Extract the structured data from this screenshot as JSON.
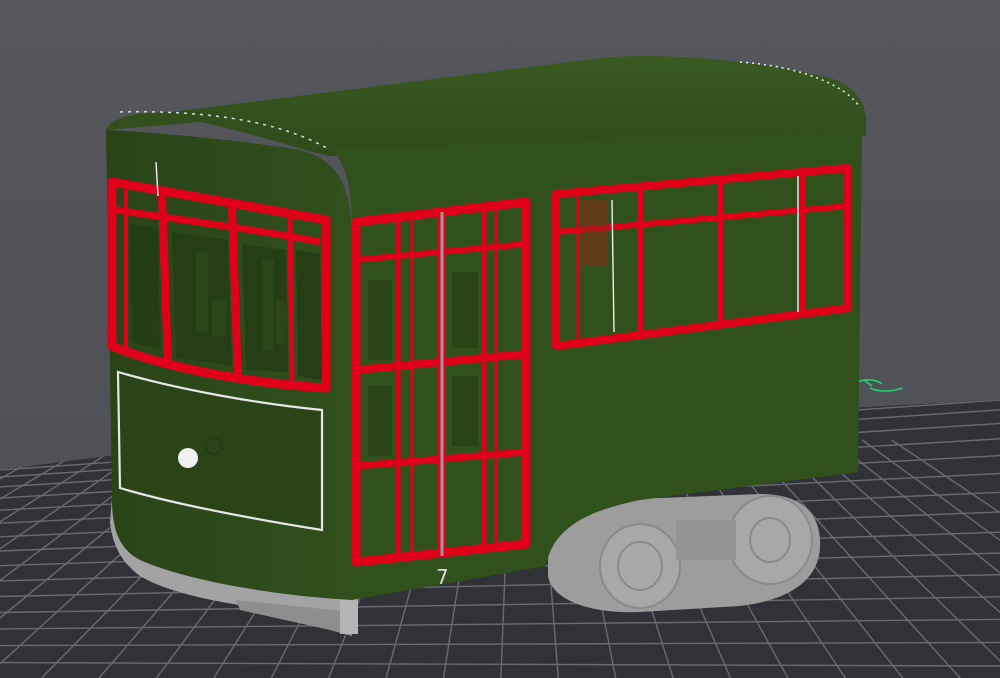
{
  "viewport": {
    "background_color": "#55565c",
    "bed_color": "#2f3036",
    "bed_grid_color": "#6a6b72"
  },
  "model": {
    "body_color": "#2f4a1c",
    "body_shade_color": "#253d15",
    "roof_color": "#35521f",
    "trim_color": "#e0001a",
    "base_color": "#9a9a9a",
    "wheel_color": "#a3a3a3",
    "headlight_color": "#f0f0f0",
    "door_number": "7"
  },
  "axis_gizmo": {
    "color": "#1fd16b",
    "icon": "axis-gizmo-icon"
  }
}
